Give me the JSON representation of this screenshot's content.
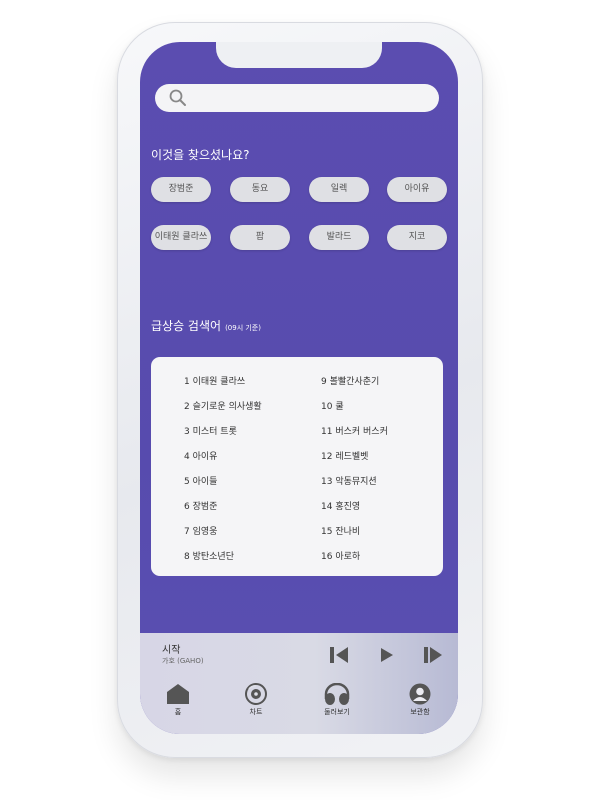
{
  "search": {
    "placeholder": ""
  },
  "suggestions": {
    "title": "이것을 찾으셨나요?",
    "chips": [
      "장범준",
      "동요",
      "일렉",
      "아이유",
      "이태원 클라쓰",
      "팝",
      "발라드",
      "지코"
    ]
  },
  "trending": {
    "title": "급상승 검색어",
    "subtitle": "(09시 기준)",
    "left": [
      "1 이태원 클라쓰",
      "2 슬기로운 의사생활",
      "3 미스터 트롯",
      "4 아이유",
      "5 아이들",
      "6 장범준",
      "7 임영웅",
      "8 방탄소년단"
    ],
    "right": [
      "9 볼빨간사춘기",
      "10 쿨",
      "11 버스커 버스커",
      "12 레드벨벳",
      "13 악동뮤지션",
      "14 홍진영",
      "15 잔나비",
      "16 아로하"
    ]
  },
  "player": {
    "title": "시작",
    "artist": "가호 (GAHO)"
  },
  "nav": {
    "home": "홈",
    "chart": "차트",
    "browse": "둘러보기",
    "library": "보관함"
  },
  "colors": {
    "background": "#574bae",
    "card": "#f5f5f7",
    "chip": "#dfe0e4"
  }
}
